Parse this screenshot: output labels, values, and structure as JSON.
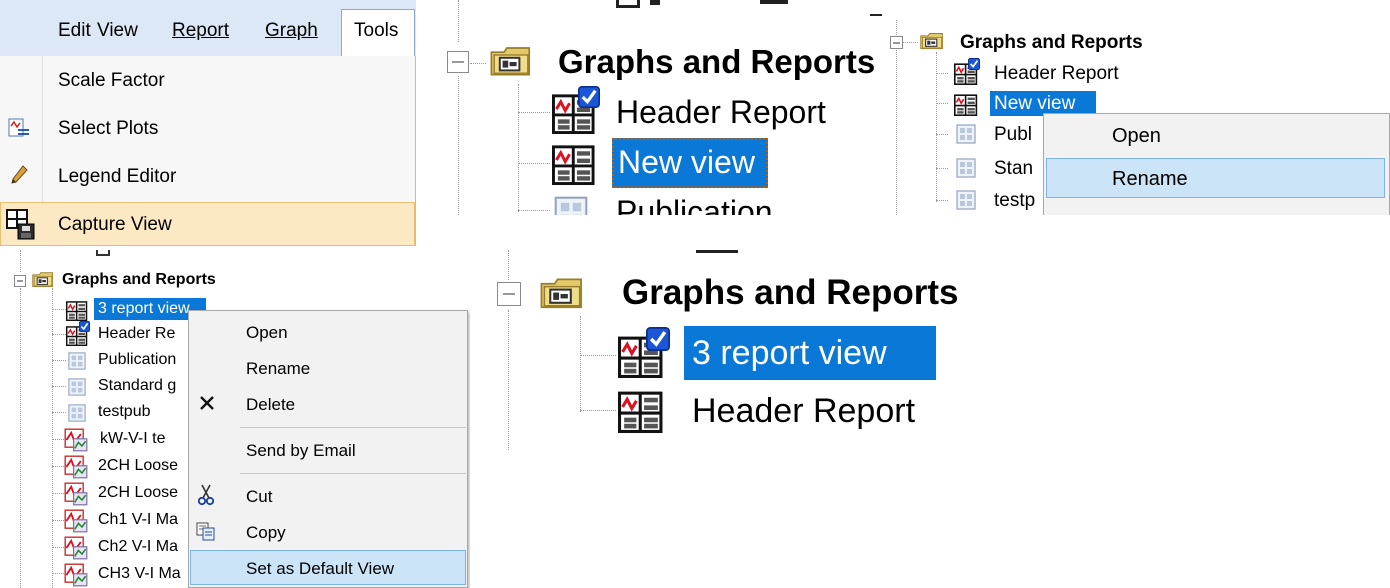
{
  "panel1": {
    "menubar": [
      "Edit",
      "View",
      "Report",
      "Graph",
      "Tools"
    ],
    "tools_menu": {
      "items": [
        {
          "label": "Scale Factor",
          "icon": ""
        },
        {
          "label": "Select Plots",
          "icon": "select-plots-icon"
        },
        {
          "label": "Legend Editor",
          "icon": "pencil-icon"
        },
        {
          "label": "Capture View",
          "icon": "capture-view-icon",
          "highlighted": true
        }
      ]
    }
  },
  "panel2": {
    "root": "Graphs and Reports",
    "items": [
      "Header Report",
      "New view",
      "Publication"
    ],
    "selected": "New view"
  },
  "panel3": {
    "root": "Graphs and Reports",
    "items": [
      "Header Report",
      "New view",
      "Publ",
      "Stan",
      "testp"
    ],
    "selected": "New view",
    "context_menu": [
      "Open",
      "Rename"
    ],
    "context_highlighted": "Rename"
  },
  "panel4": {
    "root": "Graphs and Reports",
    "items": [
      "3 report view",
      "Header Re",
      "Publication",
      "Standard g",
      "testpub",
      "kW-V-I te",
      "2CH Loose",
      "2CH Loose",
      "Ch1 V-I Ma",
      "Ch2 V-I Ma",
      "CH3 V-I Ma"
    ],
    "selected": "3 report view",
    "context_menu": {
      "items": [
        {
          "label": "Open",
          "icon": ""
        },
        {
          "label": "Rename",
          "icon": ""
        },
        {
          "label": "Delete",
          "icon": "delete-x-icon"
        },
        {
          "label": "Send by Email",
          "icon": ""
        },
        {
          "label": "Cut",
          "icon": "scissors-icon"
        },
        {
          "label": "Copy",
          "icon": "copy-icon"
        },
        {
          "label": "Set as Default View",
          "icon": "",
          "highlighted": true
        }
      ]
    }
  },
  "panel5": {
    "root": "Graphs and Reports",
    "items": [
      "3 report view",
      "Header Report"
    ],
    "selected": "3 report view"
  },
  "colors": {
    "selection": "#0a78d7",
    "menu_highlight": "#cce4f7",
    "menu_highlight_border": "#7fb4e2",
    "capture_highlight": "#fde8c4",
    "menubar_bg": "#dde8f6"
  }
}
